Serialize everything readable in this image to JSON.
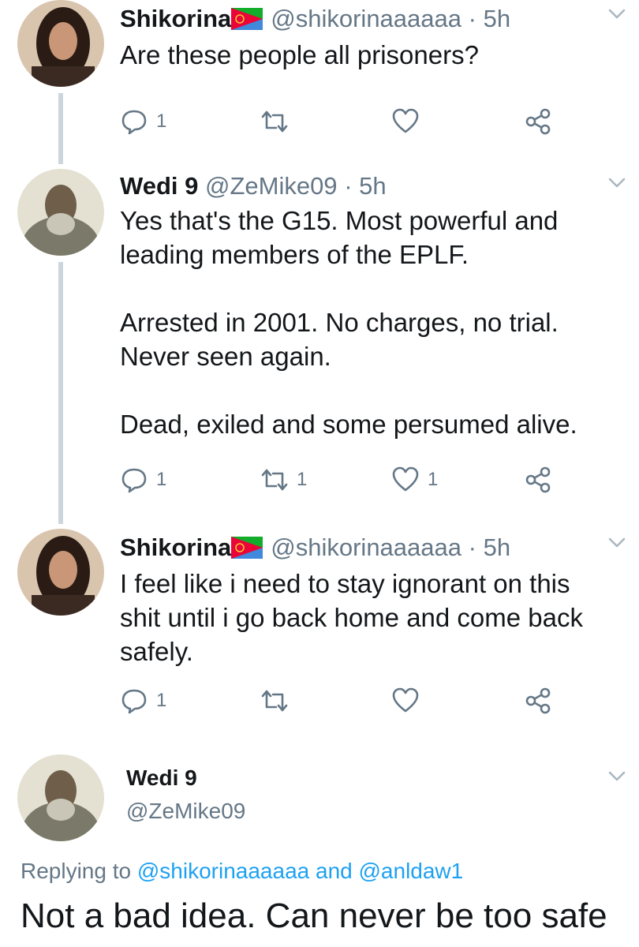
{
  "tweets": [
    {
      "name": "Shikorina",
      "handle": "@shikorinaaaaaa",
      "dot": "·",
      "time": "5h",
      "text": "Are these people all prisoners?",
      "reply_count": "1",
      "retweet_count": "",
      "like_count": ""
    },
    {
      "name": "Wedi 9",
      "handle": "@ZeMike09",
      "dot": "·",
      "time": "5h",
      "text": "Yes that's the G15. Most powerful and\nleading members of the EPLF.\n\nArrested in 2001. No charges, no trial.\nNever seen again.\n\nDead, exiled and some persumed alive.",
      "reply_count": "1",
      "retweet_count": "1",
      "like_count": "1"
    },
    {
      "name": "Shikorina",
      "handle": "@shikorinaaaaaa",
      "dot": "·",
      "time": "5h",
      "text": "I feel like i need to stay ignorant on this\nshit until i go back home and come back\nsafely.",
      "reply_count": "1",
      "retweet_count": "",
      "like_count": ""
    }
  ],
  "final_tweet": {
    "name": "Wedi 9",
    "handle": "@ZeMike09",
    "replying_prefix": "Replying to",
    "replying_user1": "@shikorinaaaaaa",
    "replying_and": "and",
    "replying_user2": "@anldaw1",
    "text": "Not a bad idea. Can never be too safe"
  },
  "colors": {
    "secondary_text": "#657786",
    "link": "#1da1f2",
    "thread_line": "#ccd6dd",
    "flag_green": "#12ad2b",
    "flag_blue": "#4189dd",
    "flag_red": "#ea0437"
  }
}
